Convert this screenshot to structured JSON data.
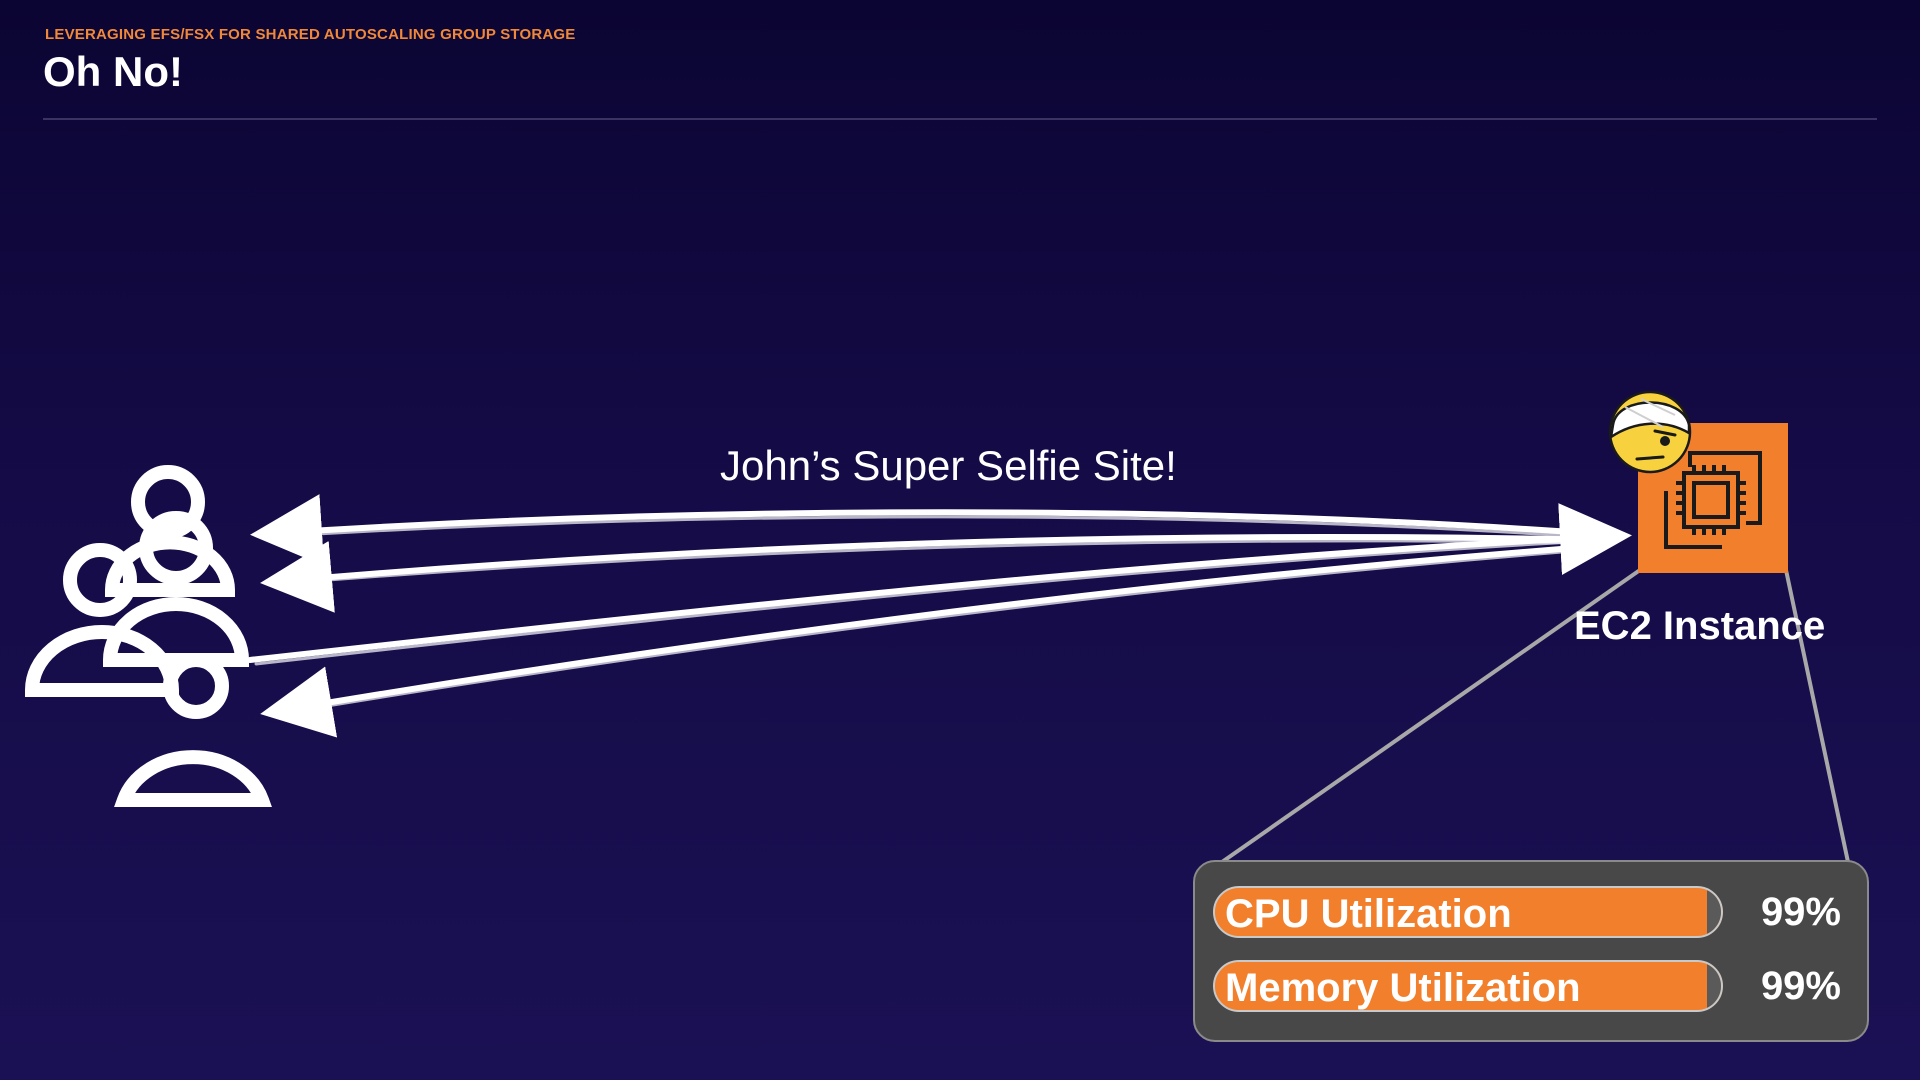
{
  "header": {
    "eyebrow": "LEVERAGING EFS/FSX FOR SHARED AUTOSCALING GROUP STORAGE",
    "title": "Oh No!"
  },
  "diagram": {
    "site_label": "John’s Super Selfie Site!",
    "ec2_label": "EC2 Instance",
    "users_icon": "users-group-icon",
    "ec2_icon": "ec2-instance-icon",
    "emoji_icon": "injured-face-emoji-icon"
  },
  "metrics": [
    {
      "label": "CPU Utilization",
      "value": "99%",
      "fill_percent": 99
    },
    {
      "label": "Memory Utilization",
      "value": "99%",
      "fill_percent": 99
    }
  ],
  "colors": {
    "accent": "#f27f2c",
    "eyebrow": "#f0883a",
    "background_top": "#0b0533",
    "background_bottom": "#1a1154",
    "panel": "#484848"
  }
}
